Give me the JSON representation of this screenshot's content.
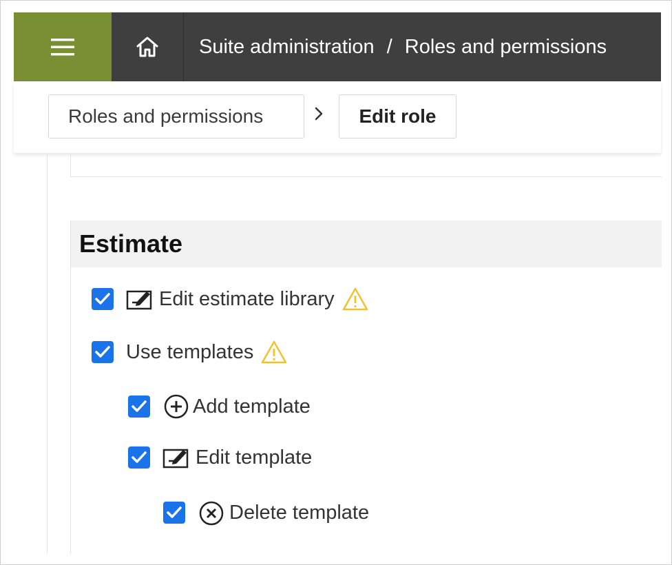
{
  "topbar": {
    "crumb1": "Suite administration",
    "separator": "/",
    "crumb2": "Roles and permissions",
    "menu_icon": "hamburger-icon",
    "home_icon": "home-icon"
  },
  "breadcrumb": {
    "item1": "Roles and permissions",
    "item2": "Edit role"
  },
  "section": {
    "title": "Estimate",
    "permissions": [
      {
        "label": "Edit estimate library",
        "checked": true,
        "icon": "edit-icon",
        "warning": true
      },
      {
        "label": "Use templates",
        "checked": true,
        "icon": "",
        "warning": true
      },
      {
        "label": "Add template",
        "checked": true,
        "icon": "add-circle-icon",
        "warning": false
      },
      {
        "label": "Edit template",
        "checked": true,
        "icon": "edit-icon",
        "warning": false
      },
      {
        "label": "Delete template",
        "checked": true,
        "icon": "delete-circle-icon",
        "warning": false
      }
    ]
  },
  "colors": {
    "menu_bg": "#7a8f33",
    "topbar_bg": "#3f3f3f",
    "checkbox": "#1a73e8",
    "warning": "#f2c12e"
  }
}
